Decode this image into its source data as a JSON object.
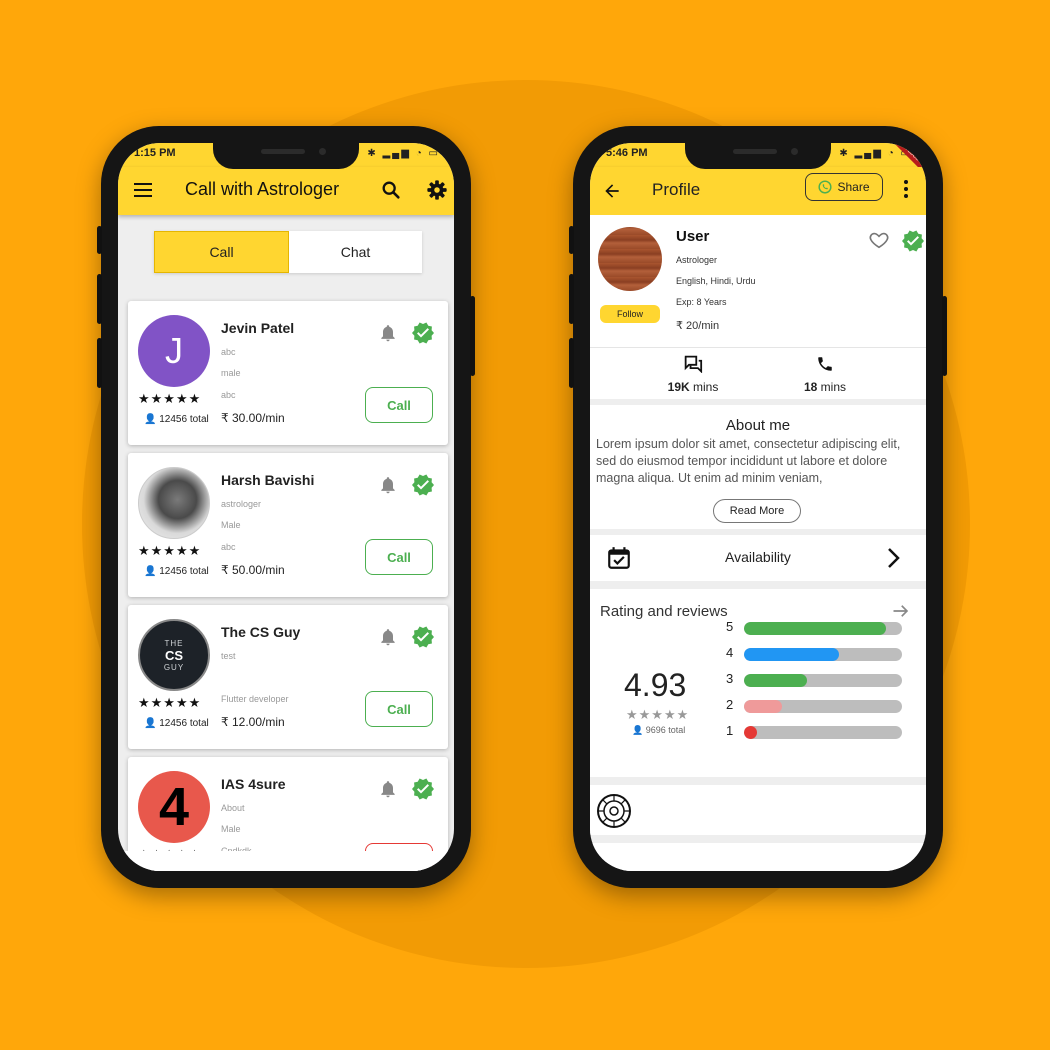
{
  "colors": {
    "background": "#FFA70A",
    "appbar": "#FFD630",
    "green": "#4CAF50",
    "blue": "#2196F3",
    "pink": "#EF9A9A",
    "red": "#E53935"
  },
  "left_phone": {
    "status_time": "1:15 PM",
    "title": "Call with Astrologer",
    "tabs": [
      "Call",
      "Chat"
    ],
    "active_tab": "Call",
    "astrologers": [
      {
        "name": "Jevin Patel",
        "avatar_letter": "J",
        "line1": "abc",
        "line2": "male",
        "line3": "abc",
        "price": "₹ 30.00/min",
        "total": "12456 total",
        "button": "Call"
      },
      {
        "name": "Harsh Bavishi",
        "line1": "astrologer",
        "line2": "Male",
        "line3": "abc",
        "price": "₹ 50.00/min",
        "total": "12456 total",
        "button": "Call"
      },
      {
        "name": "The CS Guy",
        "avatar_small": "THE",
        "avatar_big": "CS",
        "avatar_small2": "GUY",
        "line1": "test",
        "line2": "",
        "line3": "Flutter developer",
        "price": "₹ 12.00/min",
        "total": "12456 total",
        "button": "Call"
      },
      {
        "name": "IAS 4sure",
        "avatar_letter": "4",
        "line1": "About",
        "line2": "Male",
        "line3": "Cndkdk",
        "price": "",
        "total": "",
        "button": ""
      }
    ],
    "stars": "★★★★★"
  },
  "right_phone": {
    "status_time": "5:46 PM",
    "title": "Profile",
    "share_label": "Share",
    "debug_label": "DEBUG",
    "profile": {
      "name": "User",
      "role": "Astrologer",
      "languages": "English, Hindi, Urdu",
      "experience": "Exp: 8 Years",
      "price": "₹ 20/min",
      "follow_label": "Follow"
    },
    "stats": [
      {
        "value": "19K",
        "unit": " mins",
        "icon": "chat-icon"
      },
      {
        "value": "18",
        "unit": " mins",
        "icon": "phone-icon"
      }
    ],
    "about": {
      "title": "About me",
      "text": "Lorem ipsum dolor sit amet, consectetur adipiscing elit, sed do eiusmod tempor incididunt ut labore et dolore magna aliqua. Ut enim ad minim veniam,",
      "read_more": "Read More"
    },
    "availability_label": "Availability",
    "rating": {
      "title": "Rating and reviews",
      "average": "4.93",
      "stars": "★★★★★",
      "total": "9696 total",
      "distribution": [
        {
          "label": "5",
          "fraction": 0.9,
          "color": "#4CAF50"
        },
        {
          "label": "4",
          "fraction": 0.6,
          "color": "#2196F3"
        },
        {
          "label": "3",
          "fraction": 0.4,
          "color": "#4CAF50"
        },
        {
          "label": "2",
          "fraction": 0.24,
          "color": "#EF9A9A"
        },
        {
          "label": "1",
          "fraction": 0.08,
          "color": "#E53935"
        }
      ]
    }
  }
}
